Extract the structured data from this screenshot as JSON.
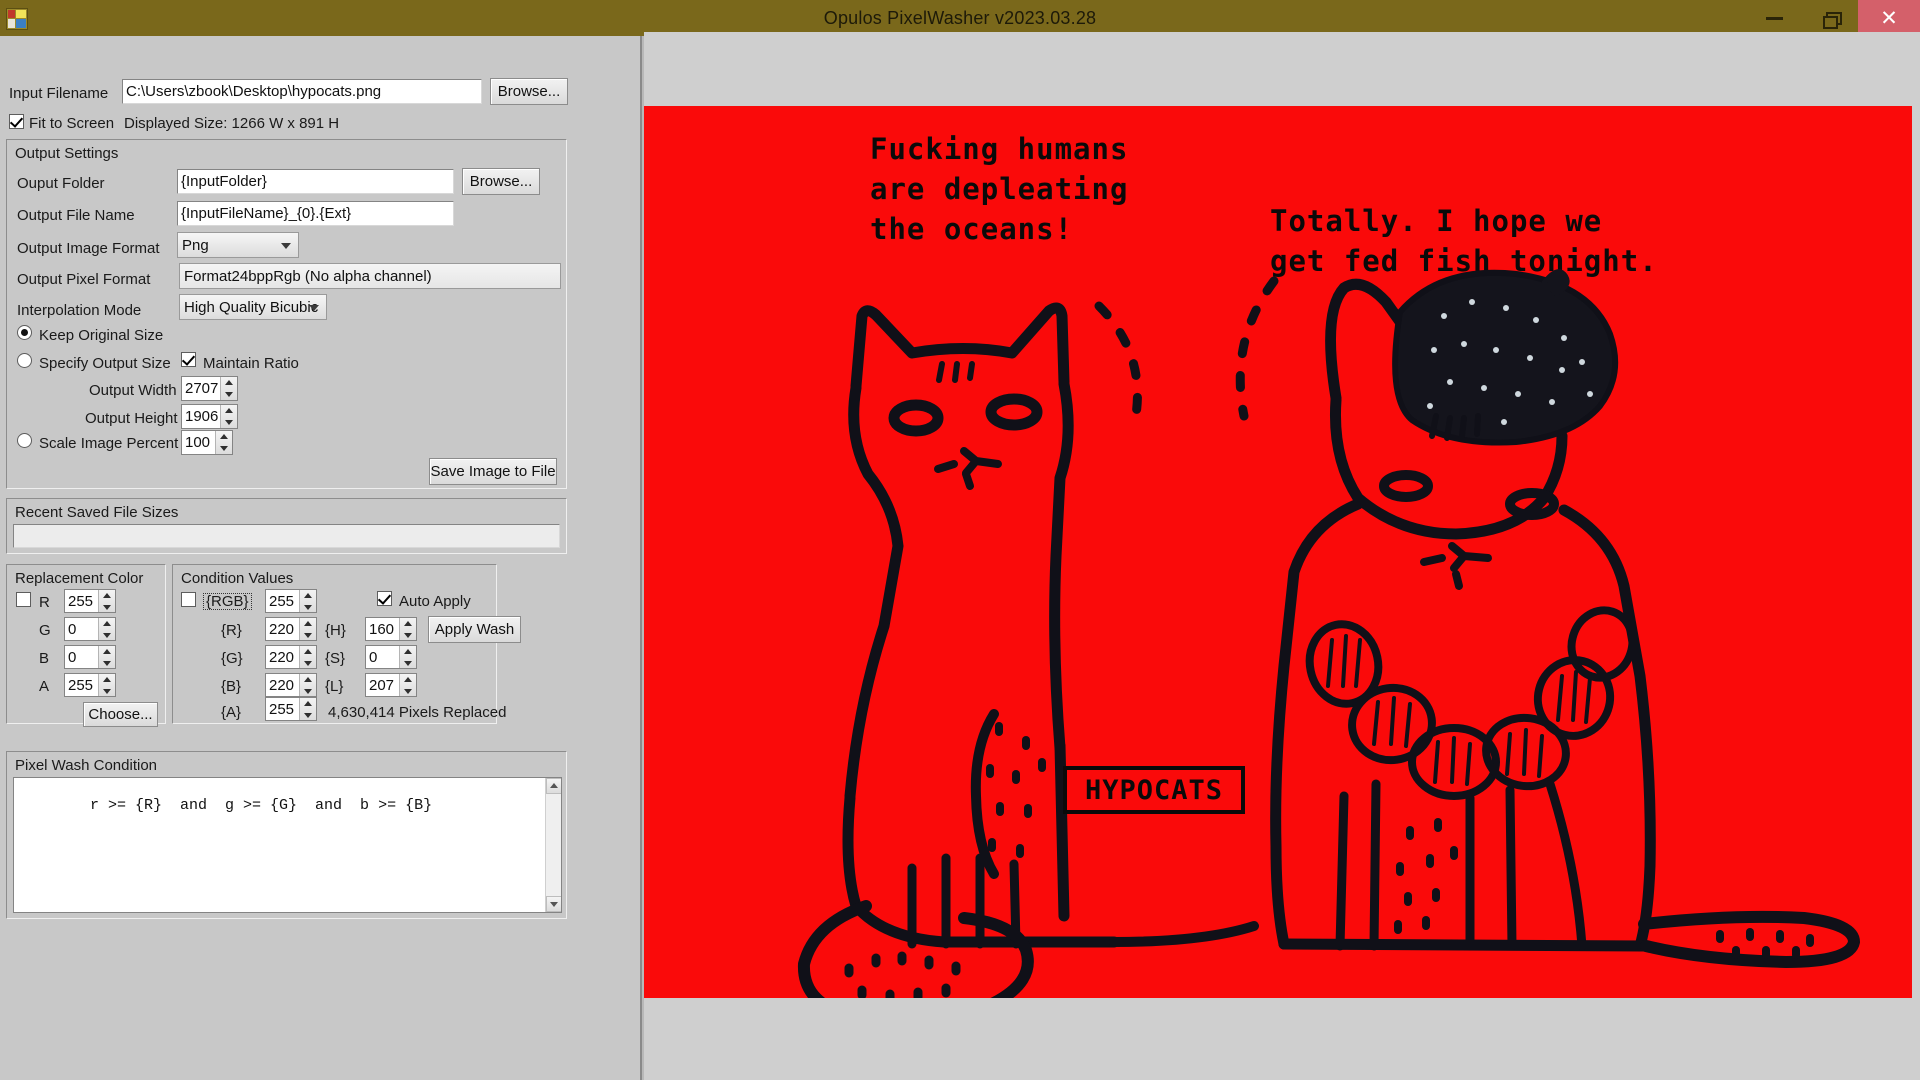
{
  "window": {
    "title": "Opulos PixelWasher v2023.03.28",
    "icon": "app-icon",
    "controls": {
      "minimize": "–",
      "maximize": "❐",
      "close": "✕"
    },
    "accent_titlebar": "#7a681b",
    "close_button_color": "#d4606a"
  },
  "input": {
    "filename_label": "Input Filename",
    "filename_value": "C:\\Users\\zbook\\Desktop\\hypocats.png",
    "browse_label": "Browse...",
    "fit_to_screen_label": "Fit to Screen",
    "fit_to_screen_checked": true,
    "displayed_size_label": "Displayed Size: 1266 W x 891 H"
  },
  "output_settings": {
    "group_title": "Output Settings",
    "output_folder_label": "Ouput Folder",
    "output_folder_value": "{InputFolder}",
    "output_folder_browse": "Browse...",
    "output_file_name_label": "Output File Name",
    "output_file_name_value": "{InputFileName}_{0}.{Ext}",
    "output_image_format_label": "Output Image Format",
    "output_image_format_value": "Png",
    "output_pixel_format_label": "Output Pixel Format",
    "output_pixel_format_value": "Format24bppRgb (No alpha channel)",
    "interpolation_mode_label": "Interpolation Mode",
    "interpolation_mode_value": "High Quality Bicubic",
    "keep_original_size_label": "Keep Original Size",
    "keep_original_size_selected": true,
    "specify_output_size_label": "Specify Output Size",
    "specify_output_size_selected": false,
    "maintain_ratio_label": "Maintain Ratio",
    "maintain_ratio_checked": true,
    "output_width_label": "Output Width",
    "output_width_value": "2707",
    "output_height_label": "Output Height",
    "output_height_value": "1906",
    "scale_image_percent_label": "Scale Image Percent",
    "scale_image_percent_selected": false,
    "scale_image_percent_value": "100",
    "save_image_button": "Save Image to File"
  },
  "recent_saved": {
    "group_title": "Recent Saved File Sizes",
    "value": ""
  },
  "replacement_color": {
    "group_title": "Replacement Color",
    "r_label": "R",
    "r_value": "255",
    "r_checked": false,
    "g_label": "G",
    "g_value": "0",
    "b_label": "B",
    "b_value": "0",
    "a_label": "A",
    "a_value": "255",
    "choose_button": "Choose..."
  },
  "condition_values": {
    "group_title": "Condition Values",
    "rgb_label": "{RGB}",
    "rgb_value": "255",
    "rgb_checked": false,
    "r_label": "{R}",
    "r_value": "220",
    "g_label": "{G}",
    "g_value": "220",
    "b_label": "{B}",
    "b_value": "220",
    "a_label": "{A}",
    "a_value": "255",
    "h_label": "{H}",
    "h_value": "160",
    "s_label": "{S}",
    "s_value": "0",
    "l_label": "{L}",
    "l_value": "207",
    "auto_apply_label": "Auto Apply",
    "auto_apply_checked": true,
    "apply_wash_button": "Apply Wash",
    "pixels_replaced_text": "4,630,414 Pixels Replaced"
  },
  "pixel_wash_condition": {
    "group_title": "Pixel Wash Condition",
    "expression": "r >= {R}  and  g >= {G}  and  b >= {B}"
  },
  "preview": {
    "background_color": "#fa0a0a",
    "speech_left": "Fucking humans\nare depleating\nthe oceans!",
    "speech_right": "Totally. I hope we\nget fed fish tonight.",
    "badge_text": "HYPOCATS"
  }
}
